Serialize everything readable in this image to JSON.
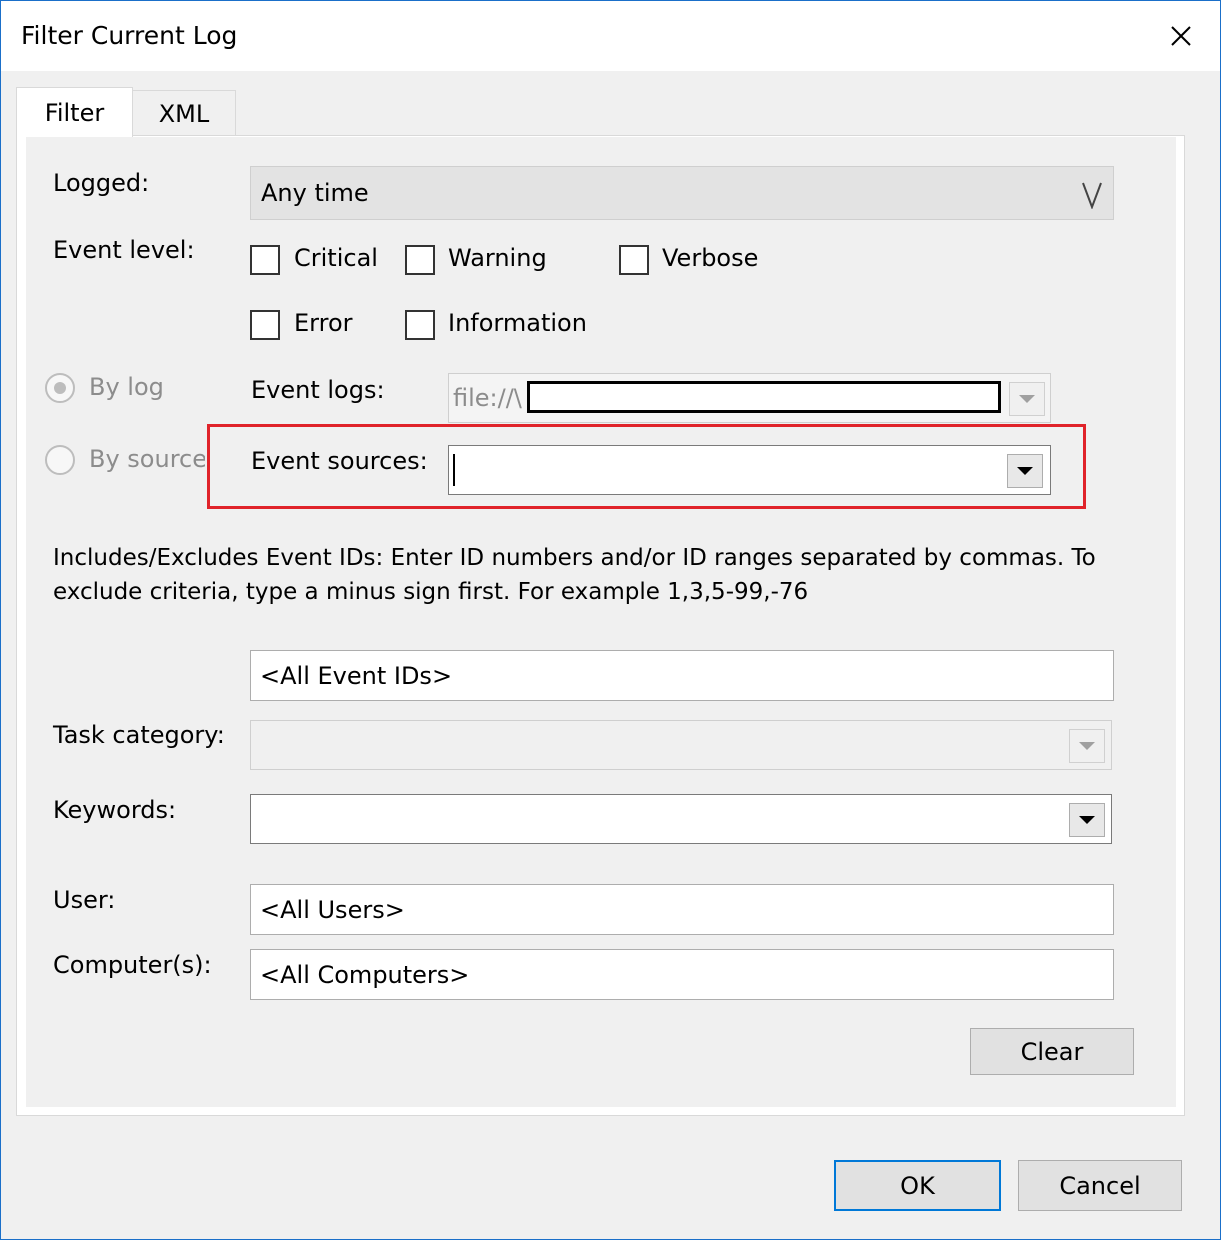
{
  "window": {
    "title": "Filter Current Log",
    "close_icon": "close-icon"
  },
  "tabs": [
    {
      "label": "Filter",
      "active": true
    },
    {
      "label": "XML",
      "active": false
    }
  ],
  "filter": {
    "logged": {
      "label": "Logged:",
      "value": "Any time"
    },
    "event_level": {
      "label": "Event level:",
      "options": [
        {
          "label": "Critical",
          "checked": false
        },
        {
          "label": "Warning",
          "checked": false
        },
        {
          "label": "Verbose",
          "checked": false
        },
        {
          "label": "Error",
          "checked": false
        },
        {
          "label": "Information",
          "checked": false
        }
      ]
    },
    "by_log": {
      "label": "By log",
      "selected": true,
      "enabled": false
    },
    "by_source": {
      "label": "By source",
      "selected": false,
      "enabled": false
    },
    "event_logs": {
      "label": "Event logs:",
      "value": "file://\\"
    },
    "event_sources": {
      "label": "Event sources:",
      "value": ""
    },
    "event_ids": {
      "description": "Includes/Excludes Event IDs: Enter ID numbers and/or ID ranges separated by commas. To exclude criteria, type a minus sign first. For example 1,3,5-99,-76",
      "value": "<All Event IDs>"
    },
    "task_category": {
      "label": "Task category:",
      "value": ""
    },
    "keywords": {
      "label": "Keywords:",
      "value": ""
    },
    "user": {
      "label": "User:",
      "value": "<All Users>"
    },
    "computers": {
      "label": "Computer(s):",
      "value": "<All Computers>"
    },
    "clear_label": "Clear"
  },
  "footer": {
    "ok_label": "OK",
    "cancel_label": "Cancel"
  },
  "colors": {
    "accent": "#0078d7",
    "highlight": "#e0232a"
  }
}
